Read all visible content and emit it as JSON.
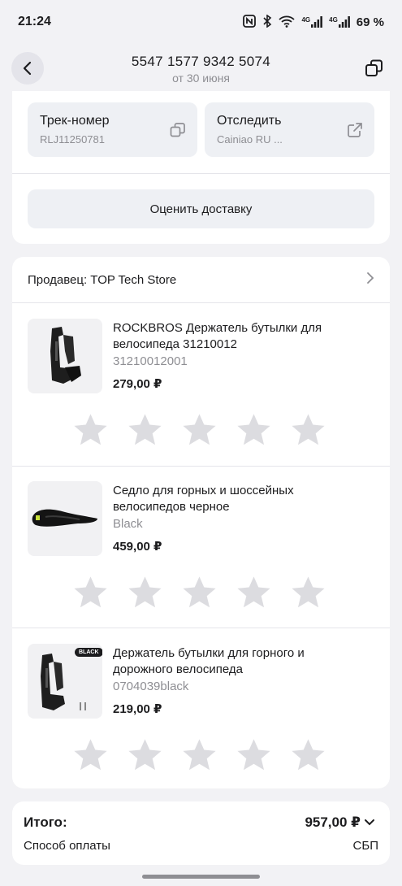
{
  "status": {
    "time": "21:24",
    "battery": "69 %",
    "net1": "4G",
    "net2": "4G"
  },
  "header": {
    "title": "5547 1577 9342 5074",
    "subtitle": "от 30 июня"
  },
  "tracking": {
    "track_label": "Трек-номер",
    "track_value": "RLJ11250781",
    "follow_label": "Отследить",
    "follow_value": "Cainiao RU ...",
    "rate_button": "Оценить доставку"
  },
  "seller": {
    "label": "Продавец: TOP Tech Store"
  },
  "items": [
    {
      "title": "ROCKBROS Держатель бутылки для велосипеда 31210012",
      "sku": "31210012001",
      "price": "279,00 ₽",
      "image": "bottle-holder-image",
      "rating": 0
    },
    {
      "title": "Седло для горных и шоссейных велосипедов черное",
      "sku": "Black",
      "price": "459,00 ₽",
      "image": "saddle-image",
      "rating": 0
    },
    {
      "title": "Держатель бутылки для горного и дорожного велосипеда",
      "sku": "0704039black",
      "price": "219,00 ₽",
      "image": "bottle-holder-image",
      "image_badge": "BLACK",
      "rating": 0
    }
  ],
  "total": {
    "label": "Итого:",
    "value": "957,00 ₽",
    "payment_label": "Способ оплаты",
    "payment_value": "СБП"
  },
  "colors": {
    "background": "#f2f2f5",
    "card": "#ffffff",
    "button": "#eef0f4",
    "muted_text": "#8e8e93",
    "star": "#dcdce0"
  }
}
